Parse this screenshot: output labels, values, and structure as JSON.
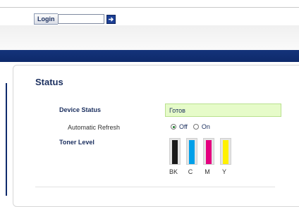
{
  "header": {
    "login_label": "Login",
    "login_value": ""
  },
  "status_panel": {
    "title": "Status",
    "device_status_label": "Device Status",
    "device_status_value": "Готов",
    "auto_refresh_label": "Automatic Refresh",
    "auto_refresh_options": [
      "Off",
      "On"
    ],
    "auto_refresh_selected": "Off",
    "toner_label": "Toner Level",
    "toner": [
      {
        "label": "BK",
        "color": "#1a1a1a",
        "level": 0.95
      },
      {
        "label": "C",
        "color": "#00a0e9",
        "level": 0.95
      },
      {
        "label": "M",
        "color": "#e4007f",
        "level": 0.95
      },
      {
        "label": "Y",
        "color": "#fff100",
        "level": 0.95
      }
    ]
  }
}
